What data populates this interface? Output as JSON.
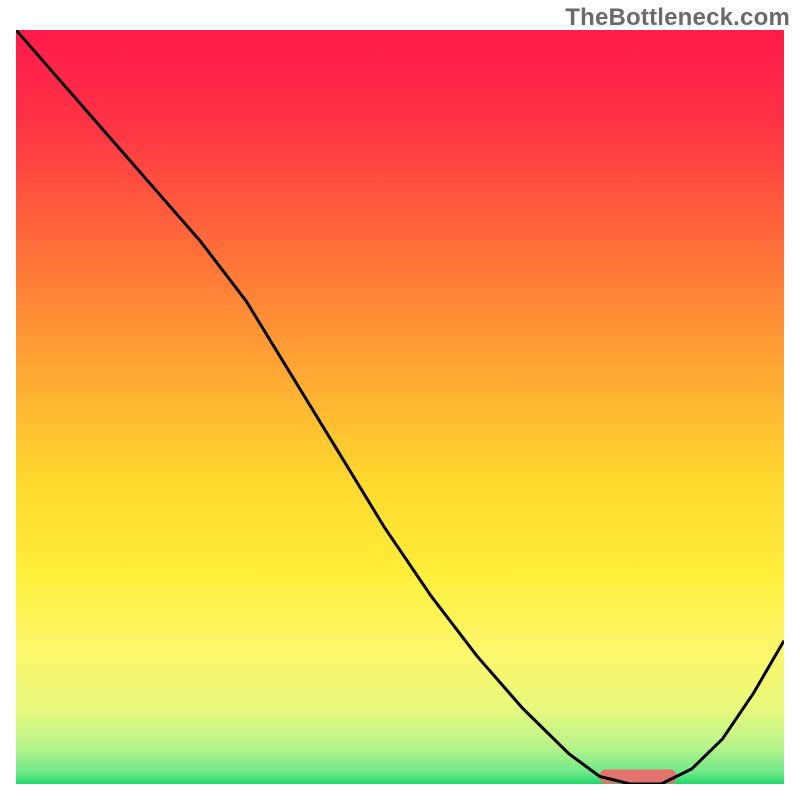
{
  "watermark": "TheBottleneck.com",
  "chart_data": {
    "type": "line",
    "title": "",
    "xlabel": "",
    "ylabel": "",
    "xlim": [
      0,
      100
    ],
    "ylim": [
      0,
      100
    ],
    "grid": false,
    "legend": false,
    "series": [
      {
        "name": "curve",
        "x": [
          0,
          6,
          12,
          18,
          24,
          30,
          36,
          42,
          48,
          54,
          60,
          66,
          72,
          76,
          80,
          84,
          88,
          92,
          96,
          100
        ],
        "y": [
          100,
          93,
          86,
          79,
          72,
          64,
          54,
          44,
          34,
          25,
          17,
          10,
          4,
          1,
          0,
          0,
          2,
          6,
          12,
          19
        ]
      }
    ],
    "optimal_band": {
      "x_start": 76,
      "x_end": 86,
      "y": 1
    },
    "gradient_stops": [
      {
        "pos": 0.0,
        "color": "#ff1a4b"
      },
      {
        "pos": 0.12,
        "color": "#ff3245"
      },
      {
        "pos": 0.28,
        "color": "#ff6a3a"
      },
      {
        "pos": 0.45,
        "color": "#ffa733"
      },
      {
        "pos": 0.6,
        "color": "#ffd92e"
      },
      {
        "pos": 0.72,
        "color": "#ffee3a"
      },
      {
        "pos": 0.82,
        "color": "#fdf86a"
      },
      {
        "pos": 0.9,
        "color": "#e8f97d"
      },
      {
        "pos": 0.95,
        "color": "#b8f48a"
      },
      {
        "pos": 0.985,
        "color": "#6fe889"
      },
      {
        "pos": 1.0,
        "color": "#22d66b"
      }
    ],
    "curve_stroke": "#000000",
    "marker_color": "#e3736e"
  }
}
